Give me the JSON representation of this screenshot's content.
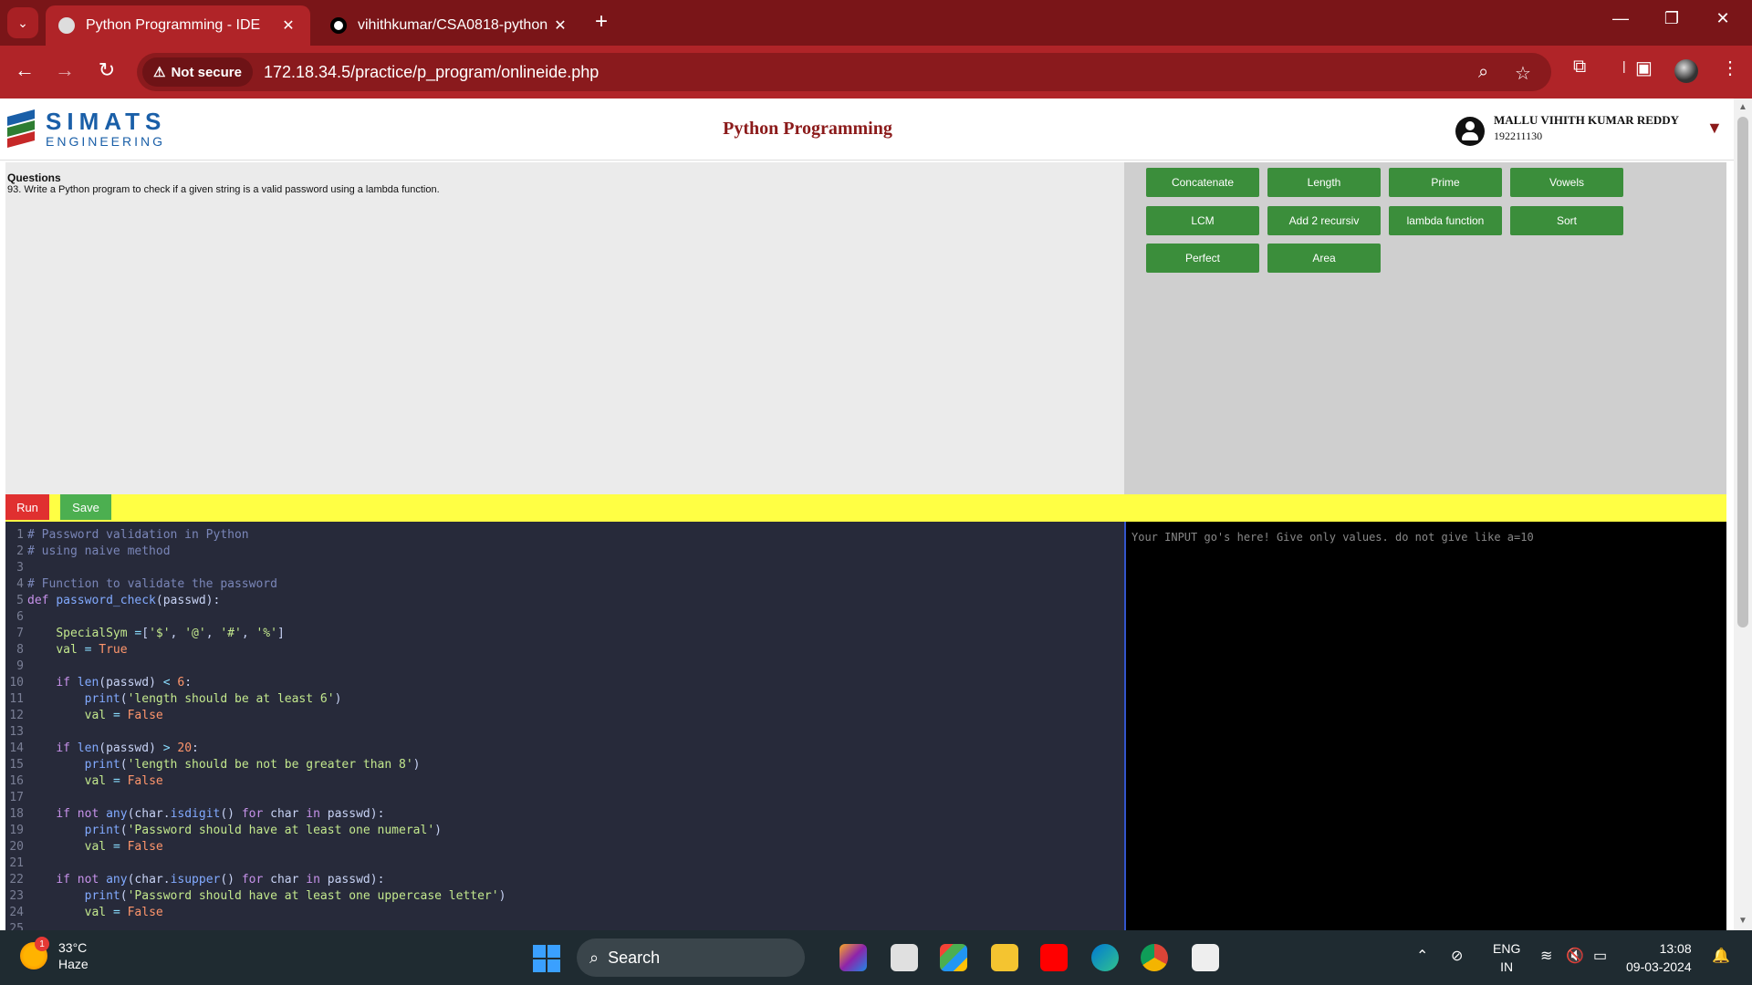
{
  "browser": {
    "tabs": [
      {
        "title": "Python Programming - IDE",
        "active": true
      },
      {
        "title": "vihithkumar/CSA0818-python",
        "active": false
      }
    ],
    "security_label": "Not secure",
    "url": "172.18.34.5/practice/p_program/onlineide.php"
  },
  "header": {
    "logo_line1": "SIMATS",
    "logo_line2": "ENGINEERING",
    "title": "Python Programming",
    "user_name": "MALLU VIHITH KUMAR REDDY",
    "user_id": "192211130",
    "caret": "▼"
  },
  "questions": {
    "heading": "Questions",
    "text": "93. Write a Python program to check if a given string is a valid password using a lambda function."
  },
  "topic_buttons": [
    "Concatenate",
    "Length",
    "Prime",
    "Vowels",
    "LCM",
    "Add 2 recursiv",
    "lambda function",
    "Sort",
    "Perfect",
    "Area"
  ],
  "actions": {
    "run": "Run",
    "save": "Save"
  },
  "editor": {
    "lines": [
      [
        [
          "c-cm",
          "# Password validation in Python"
        ]
      ],
      [
        [
          "c-cm",
          "# using naive method"
        ]
      ],
      [],
      [
        [
          "c-cm",
          "# Function to validate the password"
        ]
      ],
      [
        [
          "c-kw",
          "def "
        ],
        [
          "c-fn",
          "password_check"
        ],
        [
          "code",
          "(passwd):"
        ]
      ],
      [],
      [
        [
          "code",
          "    "
        ],
        [
          "c-vr",
          "SpecialSym "
        ],
        [
          "c-op",
          "="
        ],
        [
          "code",
          "["
        ],
        [
          "c-st",
          "'$'"
        ],
        [
          "code",
          ", "
        ],
        [
          "c-st",
          "'@'"
        ],
        [
          "code",
          ", "
        ],
        [
          "c-st",
          "'#'"
        ],
        [
          "code",
          ", "
        ],
        [
          "c-st",
          "'%'"
        ],
        [
          "code",
          "]"
        ]
      ],
      [
        [
          "code",
          "    "
        ],
        [
          "c-vr",
          "val "
        ],
        [
          "c-op",
          "= "
        ],
        [
          "c-nm",
          "True"
        ]
      ],
      [],
      [
        [
          "code",
          "    "
        ],
        [
          "c-kw",
          "if "
        ],
        [
          "c-fn",
          "len"
        ],
        [
          "code",
          "(passwd) "
        ],
        [
          "c-op",
          "< "
        ],
        [
          "c-nm",
          "6"
        ],
        [
          "code",
          ":"
        ]
      ],
      [
        [
          "code",
          "        "
        ],
        [
          "c-fn",
          "print"
        ],
        [
          "code",
          "("
        ],
        [
          "c-st",
          "'length should be at least 6'"
        ],
        [
          "code",
          ")"
        ]
      ],
      [
        [
          "code",
          "        "
        ],
        [
          "c-vr",
          "val "
        ],
        [
          "c-op",
          "= "
        ],
        [
          "c-nm",
          "False"
        ]
      ],
      [],
      [
        [
          "code",
          "    "
        ],
        [
          "c-kw",
          "if "
        ],
        [
          "c-fn",
          "len"
        ],
        [
          "code",
          "(passwd) "
        ],
        [
          "c-op",
          "> "
        ],
        [
          "c-nm",
          "20"
        ],
        [
          "code",
          ":"
        ]
      ],
      [
        [
          "code",
          "        "
        ],
        [
          "c-fn",
          "print"
        ],
        [
          "code",
          "("
        ],
        [
          "c-st",
          "'length should be not be greater than 8'"
        ],
        [
          "code",
          ")"
        ]
      ],
      [
        [
          "code",
          "        "
        ],
        [
          "c-vr",
          "val "
        ],
        [
          "c-op",
          "= "
        ],
        [
          "c-nm",
          "False"
        ]
      ],
      [],
      [
        [
          "code",
          "    "
        ],
        [
          "c-kw",
          "if not "
        ],
        [
          "c-fn",
          "any"
        ],
        [
          "code",
          "(char."
        ],
        [
          "c-fn",
          "isdigit"
        ],
        [
          "code",
          "() "
        ],
        [
          "c-kw",
          "for "
        ],
        [
          "code",
          "char "
        ],
        [
          "c-kw",
          "in "
        ],
        [
          "code",
          "passwd):"
        ]
      ],
      [
        [
          "code",
          "        "
        ],
        [
          "c-fn",
          "print"
        ],
        [
          "code",
          "("
        ],
        [
          "c-st",
          "'Password should have at least one numeral'"
        ],
        [
          "code",
          ")"
        ]
      ],
      [
        [
          "code",
          "        "
        ],
        [
          "c-vr",
          "val "
        ],
        [
          "c-op",
          "= "
        ],
        [
          "c-nm",
          "False"
        ]
      ],
      [],
      [
        [
          "code",
          "    "
        ],
        [
          "c-kw",
          "if not "
        ],
        [
          "c-fn",
          "any"
        ],
        [
          "code",
          "(char."
        ],
        [
          "c-fn",
          "isupper"
        ],
        [
          "code",
          "() "
        ],
        [
          "c-kw",
          "for "
        ],
        [
          "code",
          "char "
        ],
        [
          "c-kw",
          "in "
        ],
        [
          "code",
          "passwd):"
        ]
      ],
      [
        [
          "code",
          "        "
        ],
        [
          "c-fn",
          "print"
        ],
        [
          "code",
          "("
        ],
        [
          "c-st",
          "'Password should have at least one uppercase letter'"
        ],
        [
          "code",
          ")"
        ]
      ],
      [
        [
          "code",
          "        "
        ],
        [
          "c-vr",
          "val "
        ],
        [
          "c-op",
          "= "
        ],
        [
          "c-nm",
          "False"
        ]
      ],
      []
    ]
  },
  "input_placeholder": "Your INPUT go's here! Give only values. do not give like a=10",
  "taskbar": {
    "temperature": "33°C",
    "condition": "Haze",
    "weather_badge": "1",
    "search_label": "Search",
    "lang_top": "ENG",
    "lang_bottom": "IN",
    "time": "13:08",
    "date": "09-03-2024"
  },
  "colors": {
    "tab_bar": "#7a1518",
    "toolbar": "#b02428",
    "button_green": "#3b8e3b",
    "run_red": "#e03030",
    "runbar_yellow": "#ffff44",
    "editor_bg": "#272a3a"
  }
}
